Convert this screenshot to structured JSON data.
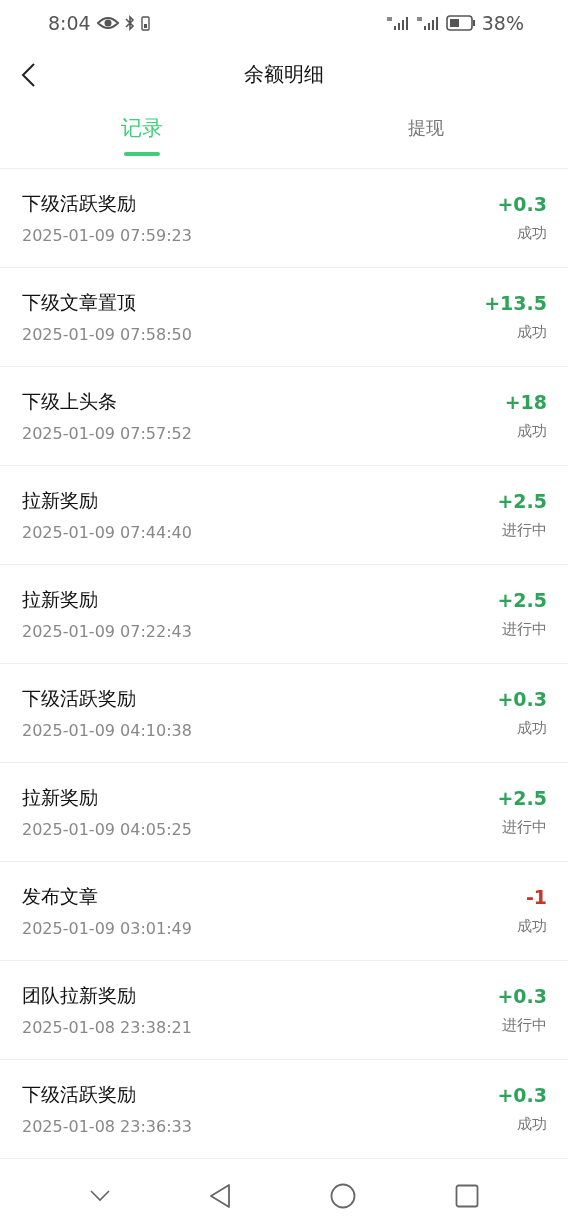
{
  "status_bar": {
    "time": "8:04",
    "battery": "38%"
  },
  "header": {
    "title": "余额明细"
  },
  "tabs": [
    {
      "label": "记录",
      "selected": true
    },
    {
      "label": "提现",
      "selected": false
    }
  ],
  "records": [
    {
      "title": "下级活跃奖励",
      "time": "2025-01-09 07:59:23",
      "amount": "+0.3",
      "color": "#2fa35a",
      "status": "成功"
    },
    {
      "title": "下级文章置顶",
      "time": "2025-01-09 07:58:50",
      "amount": "+13.5",
      "color": "#2fa35a",
      "status": "成功"
    },
    {
      "title": "下级上头条",
      "time": "2025-01-09 07:57:52",
      "amount": "+18",
      "color": "#2fa35a",
      "status": "成功"
    },
    {
      "title": "拉新奖励",
      "time": "2025-01-09 07:44:40",
      "amount": "+2.5",
      "color": "#2fa35a",
      "status": "进行中"
    },
    {
      "title": "拉新奖励",
      "time": "2025-01-09 07:22:43",
      "amount": "+2.5",
      "color": "#2fa35a",
      "status": "进行中"
    },
    {
      "title": "下级活跃奖励",
      "time": "2025-01-09 04:10:38",
      "amount": "+0.3",
      "color": "#2fa35a",
      "status": "成功"
    },
    {
      "title": "拉新奖励",
      "time": "2025-01-09 04:05:25",
      "amount": "+2.5",
      "color": "#2fa35a",
      "status": "进行中"
    },
    {
      "title": "发布文章",
      "time": "2025-01-09 03:01:49",
      "amount": "-1",
      "color": "#c0392b",
      "status": "成功"
    },
    {
      "title": "团队拉新奖励",
      "time": "2025-01-08 23:38:21",
      "amount": "+0.3",
      "color": "#2fa35a",
      "status": "进行中"
    },
    {
      "title": "下级活跃奖励",
      "time": "2025-01-08 23:36:33",
      "amount": "+0.3",
      "color": "#2fa35a",
      "status": "成功"
    }
  ]
}
